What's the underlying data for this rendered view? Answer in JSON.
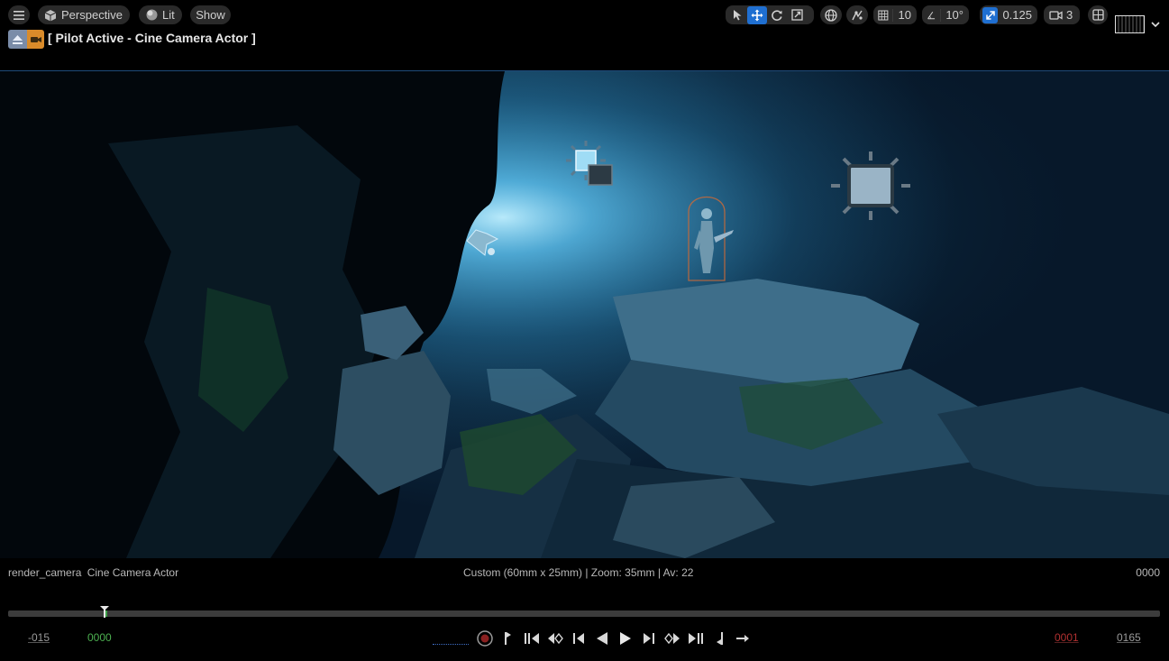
{
  "toolbar": {
    "viewport_mode": "Perspective",
    "view_mode": "Lit",
    "show_label": "Show",
    "grid_snap_value": "10",
    "rotation_snap_value": "10°",
    "scale_snap_value": "0.125",
    "camera_speed_value": "3",
    "accent_color": "#1f6fd1"
  },
  "pilot": {
    "title": "[ Pilot Active - Cine Camera Actor ]"
  },
  "viewport_status": {
    "camera_name": "render_camera",
    "camera_type": "Cine Camera Actor",
    "camera_info": "Custom (60mm x 25mm) | Zoom: 35mm | Av: 22",
    "frame_counter": "0000"
  },
  "timeline": {
    "start_frame": "-015",
    "current_frame": "0000",
    "playback_start": "0001",
    "end_frame": "0165"
  },
  "icons": {
    "menu": "hamburger-icon",
    "perspective": "cube-icon",
    "lit": "sphere-icon",
    "select": "cursor-icon",
    "translate": "move-icon",
    "rotate": "rotate-icon",
    "scale": "scale-icon",
    "world": "globe-icon",
    "surface_snap": "surface-snap-icon",
    "grid": "grid-icon",
    "angle": "angle-icon",
    "scale_snap": "scale-snap-icon",
    "camera": "camera-icon",
    "layout": "layout-icon"
  }
}
